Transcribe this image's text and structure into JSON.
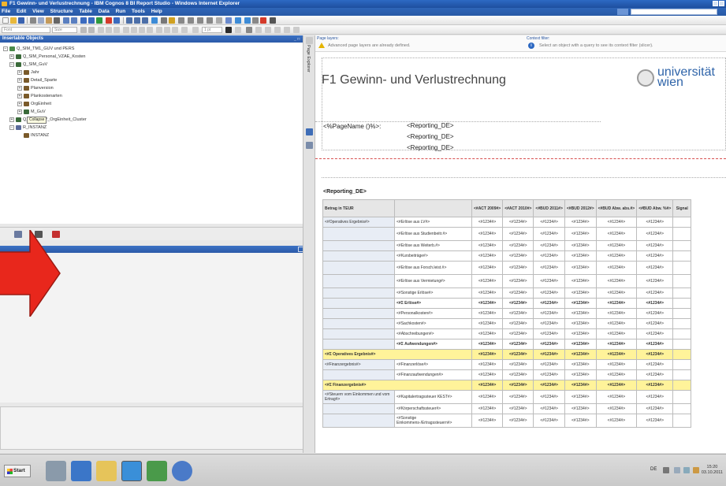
{
  "window": {
    "title": "F1 Gewinn- und Verlustrechnung - IBM Cognos 8 BI Report Studio - Windows Internet Explorer"
  },
  "menu": {
    "items": [
      "File",
      "Edit",
      "View",
      "Structure",
      "Table",
      "Data",
      "Run",
      "Tools",
      "Help"
    ]
  },
  "toolbar": {
    "font_field": "Font",
    "size_field": "Size",
    "line_width": "1 pt"
  },
  "left_panel": {
    "title": "Insertable Objects",
    "tooltip": "Collapse",
    "tree": [
      {
        "label": "Q_SIM_TM1_GUV und PERS",
        "level": 0
      },
      {
        "label": "Q_SIM_Personal_VZAE_Kosten",
        "level": 1
      },
      {
        "label": "Q_SIM_GuV",
        "level": 1
      },
      {
        "label": "Jahr",
        "level": 2
      },
      {
        "label": "Detail_Sparte",
        "level": 2
      },
      {
        "label": "Planversion",
        "level": 2
      },
      {
        "label": "Plankostenarten",
        "level": 2
      },
      {
        "label": "OrgEinheit",
        "level": 2
      },
      {
        "label": "M_GuV",
        "level": 2
      },
      {
        "label": "Q_SIM_GuV_OrgEinheit_Cluster",
        "level": 1
      },
      {
        "label": "R_INSTANZ",
        "level": 1
      },
      {
        "label": "INSTANZ",
        "level": 2
      }
    ]
  },
  "vstrip": {
    "label": "Page Explorer"
  },
  "canvas": {
    "page_layers_title": "Page layers:",
    "page_layers_text": "Advanced page layers are already defined.",
    "context_filter_title": "Context filter:",
    "context_filter_text": "Select an object with a query to see its context filter (slicer).",
    "report_title": "F1 Gewinn- und Verlustrechnung",
    "logo_text": "universität wien",
    "page_name": "<%PageName ()%>:",
    "header_reporting": [
      "<Reporting_DE>",
      "<Reporting_DE>",
      "<Reporting_DE>"
    ],
    "table_label": "<Reporting_DE>"
  },
  "table": {
    "headers": [
      "Betrag in TEUR",
      "",
      "<#ACT 2009#>",
      "<#ACT 2010#>",
      "<#BUD 2011#>",
      "<#BUD 2012#>",
      "<#BUD Abw. abs.#>",
      "<#BUD Abw. %#>",
      "Signal"
    ],
    "cell_value": "<#1234#>",
    "rows": [
      {
        "group": "<#Operatives Ergebnis#>",
        "label": "<#Erlöse aus LV#>",
        "style": "normal",
        "tall": false
      },
      {
        "group": "",
        "label": "<#Erlöse aus Studienbeitr.#>",
        "style": "normal",
        "tall": true
      },
      {
        "group": "",
        "label": "<#Erlöse aus Weiterb.#>",
        "style": "normal",
        "tall": false
      },
      {
        "group": "",
        "label": "<#Kursbeiträge#>",
        "style": "normal",
        "tall": false
      },
      {
        "group": "",
        "label": "<#Erlöse aus Forsch.leist.#>",
        "style": "normal",
        "tall": true
      },
      {
        "group": "",
        "label": "<#Erlöse aus Vermietung#>",
        "style": "normal",
        "tall": true
      },
      {
        "group": "",
        "label": "<#Sonstige Erlöse#>",
        "style": "normal",
        "tall": false
      },
      {
        "group": "",
        "label": "<#Σ Erlöse#>",
        "style": "bold",
        "tall": false
      },
      {
        "group": "",
        "label": "<#Personalkosten#>",
        "style": "normal",
        "tall": false
      },
      {
        "group": "",
        "label": "<#Sachkosten#>",
        "style": "normal",
        "tall": false
      },
      {
        "group": "",
        "label": "<#Abschreibungen#>",
        "style": "normal",
        "tall": false
      },
      {
        "group": "",
        "label": "<#Σ Aufwendungen#>",
        "style": "bold",
        "tall": false
      },
      {
        "group": "<#Σ Operatives Ergebnis#>",
        "label": "",
        "style": "yellow",
        "tall": false
      },
      {
        "group": "<#Finanzergebnis#>",
        "label": "<#Finanzerlöse#>",
        "style": "normal",
        "tall": false
      },
      {
        "group": "",
        "label": "<#Finanzaufwendungen#>",
        "style": "normal",
        "tall": false
      },
      {
        "group": "<#Σ Finanzergebnis#>",
        "label": "",
        "style": "yellow",
        "tall": false
      },
      {
        "group": "<#Steuern vom Einkommen und vom Ertrag#>",
        "label": "<#Kapitalertragssteuer KEST#>",
        "style": "normal",
        "tall": true
      },
      {
        "group": "",
        "label": "<#Körperschaftssteuer#>",
        "style": "normal",
        "tall": false
      },
      {
        "group": "",
        "label": "<#Sonstige Einkommens-/Ertragssteuern#>",
        "style": "normal",
        "tall": true
      }
    ]
  },
  "taskbar": {
    "start_label": "Start",
    "language": "DE",
    "time": "15:20",
    "date": "03.10.2011"
  },
  "colors": {
    "titlebar": "#1e4f9e",
    "highlight_row": "#fff39a",
    "logo_blue": "#2f64a9",
    "arrow_red": "#e8271c"
  }
}
